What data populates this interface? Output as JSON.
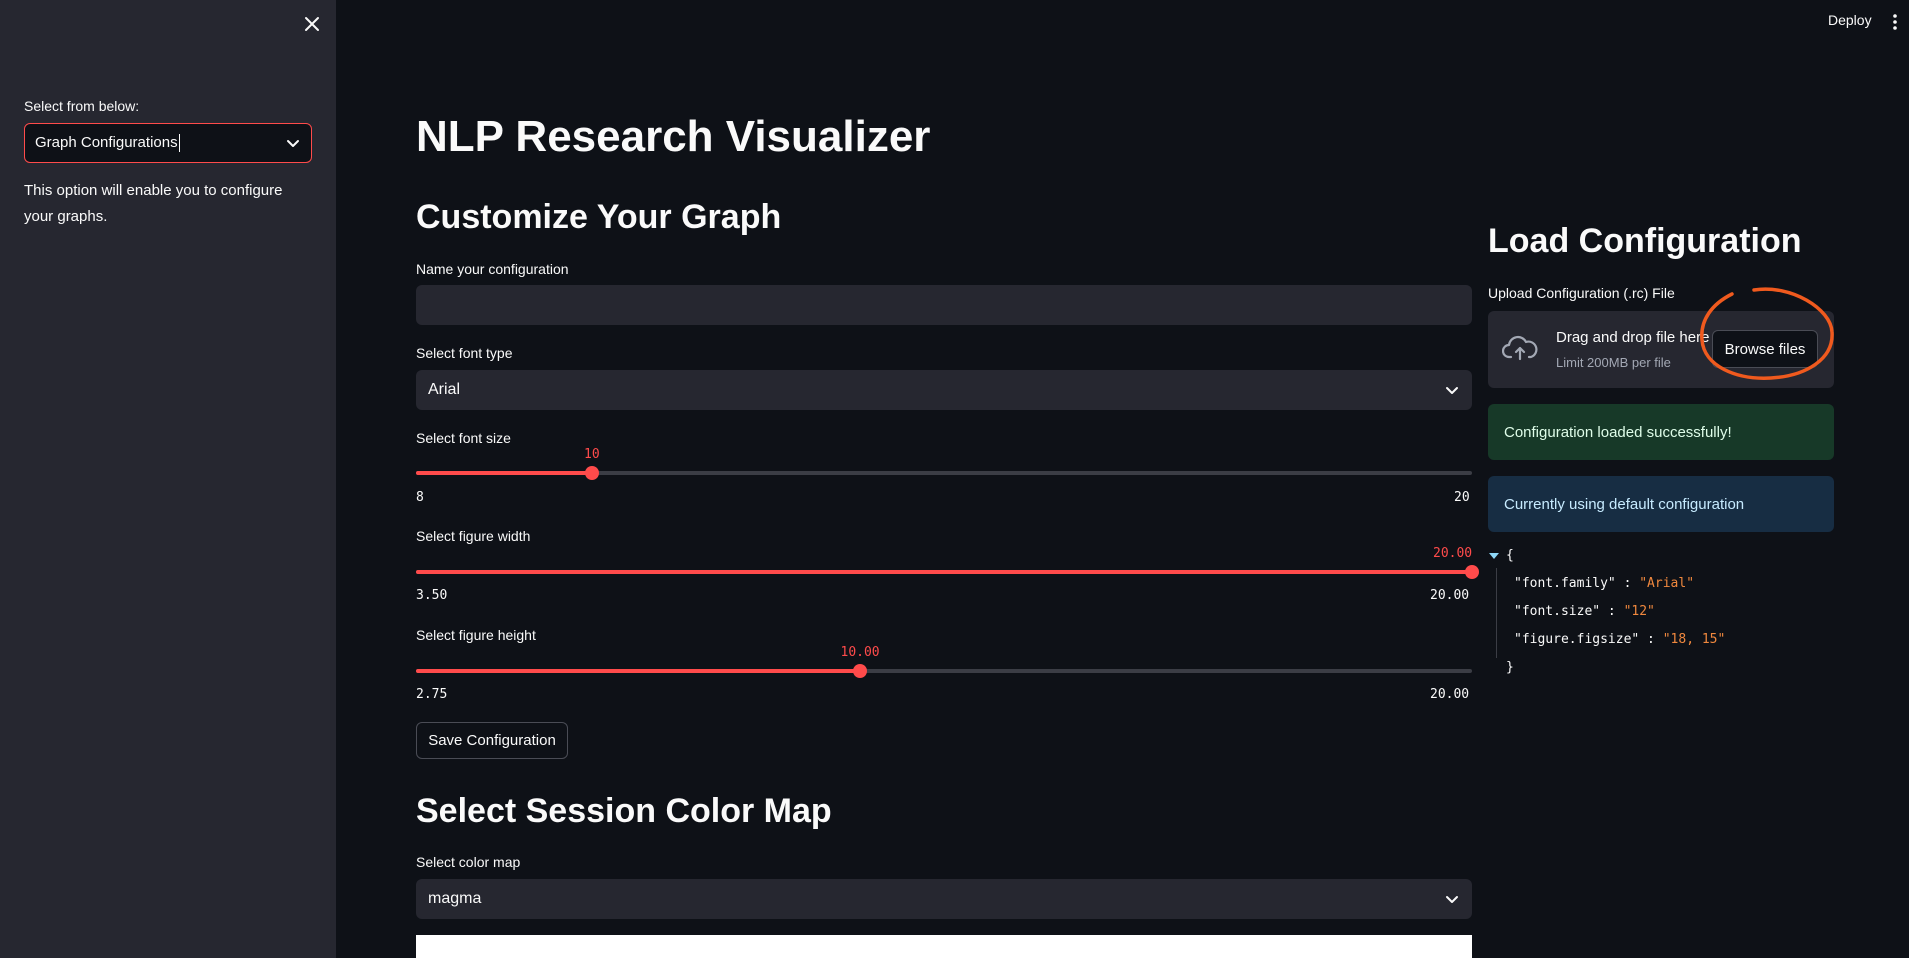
{
  "sidebar": {
    "select_label": "Select from below:",
    "select_value": "Graph Configurations",
    "description": "This option will enable you to configure your graphs."
  },
  "header": {
    "deploy_label": "Deploy"
  },
  "main": {
    "title": "NLP Research Visualizer",
    "customize_heading": "Customize Your Graph",
    "config_name": {
      "label": "Name your configuration",
      "value": ""
    },
    "font_type": {
      "label": "Select font type",
      "value": "Arial"
    },
    "font_size": {
      "label": "Select font size",
      "value": "10",
      "min": "8",
      "max": "20",
      "fraction": 0.1667
    },
    "fig_width": {
      "label": "Select figure width",
      "value": "20.00",
      "min": "3.50",
      "max": "20.00",
      "fraction": 1.0
    },
    "fig_height": {
      "label": "Select figure height",
      "value": "10.00",
      "min": "2.75",
      "max": "20.00",
      "fraction": 0.4203
    },
    "save_button": "Save Configuration",
    "colormap_heading": "Select Session Color Map",
    "colormap": {
      "label": "Select color map",
      "value": "magma"
    }
  },
  "right": {
    "heading": "Load Configuration",
    "upload_label": "Upload Configuration (.rc) File",
    "drag_text": "Drag and drop file here",
    "limit_text": "Limit 200MB per file",
    "browse_button": "Browse files",
    "success_msg": "Configuration loaded successfully!",
    "info_msg": "Currently using default configuration",
    "json_open": "{",
    "json_close": "}",
    "json_entries": [
      {
        "key": "\"font.family\"",
        "sep": " : ",
        "value": "\"Arial\""
      },
      {
        "key": "\"font.size\"",
        "sep": " : ",
        "value": "\"12\""
      },
      {
        "key": "\"figure.figsize\"",
        "sep": " : ",
        "value": "\"18, 15\""
      }
    ]
  },
  "colors": {
    "accent": "#ff4b4b",
    "background": "#0e1117",
    "sidebar": "#262730",
    "annotation": "#f05a1e"
  }
}
